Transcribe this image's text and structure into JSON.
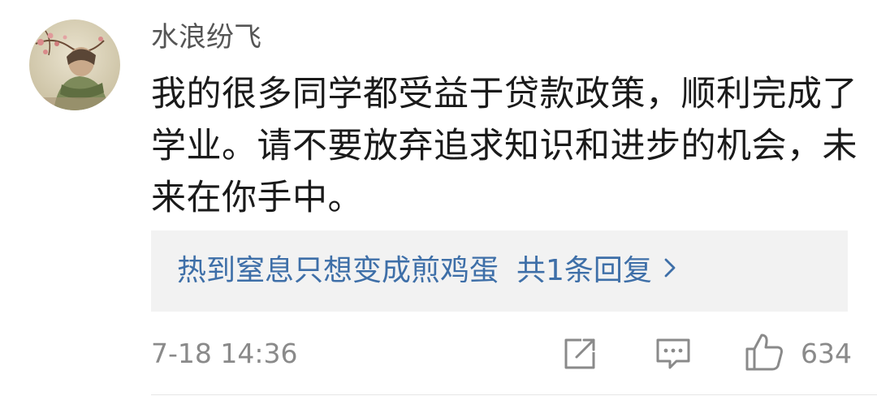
{
  "comment": {
    "avatar_icon": "user-avatar-flower-painting",
    "username": "水浪纷飞",
    "content": "我的很多同学都受益于贷款政策，顺利完成了学业。请不要放弃追求知识和进步的机会，未来在你手中。",
    "reply_preview": {
      "author": "热到窒息只想变成煎鸡蛋",
      "summary": "共1条回复",
      "icon": "chevron-right-icon"
    },
    "timestamp": "7-18 14:36",
    "actions": {
      "share_icon": "share-icon",
      "comment_icon": "comment-icon",
      "like_icon": "thumbs-up-icon",
      "like_count": "634"
    },
    "colors": {
      "link_blue": "#3e6fa8",
      "meta_gray": "#8a8a8a",
      "reply_background": "#f2f2f2"
    }
  }
}
